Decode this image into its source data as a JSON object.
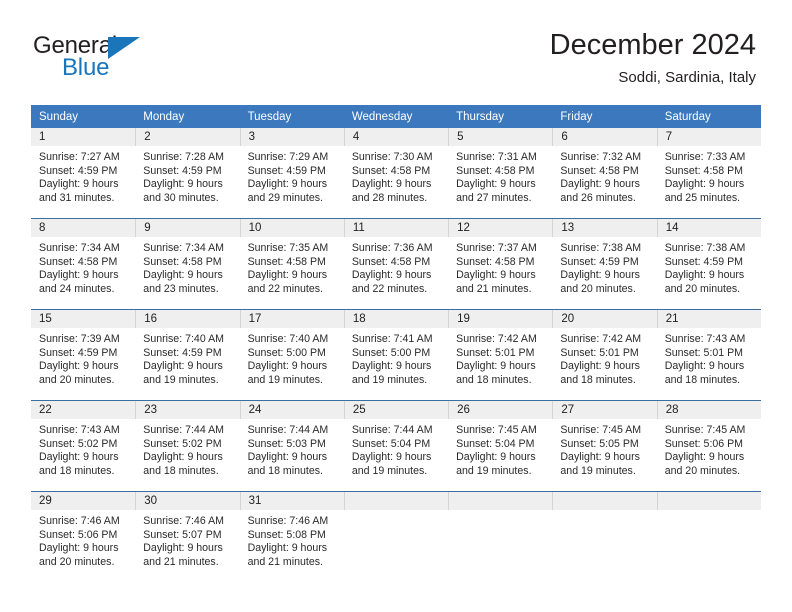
{
  "brand": {
    "name_top": "General",
    "name_bottom": "Blue",
    "accent_color": "#1b75bb",
    "text_color": "#231f20"
  },
  "header": {
    "title": "December 2024",
    "subtitle": "Soddi, Sardinia, Italy"
  },
  "theme": {
    "header_row_bg": "#3b78bd",
    "header_row_text": "#ffffff",
    "daynum_band_bg": "#efefef",
    "row_separator": "#3b6ea5",
    "cell_text": "#2a2a2a"
  },
  "weekday_headers": [
    "Sunday",
    "Monday",
    "Tuesday",
    "Wednesday",
    "Thursday",
    "Friday",
    "Saturday"
  ],
  "weeks": [
    [
      {
        "day": "1",
        "sunrise": "Sunrise: 7:27 AM",
        "sunset": "Sunset: 4:59 PM",
        "daylight_line1": "Daylight: 9 hours",
        "daylight_line2": "and 31 minutes."
      },
      {
        "day": "2",
        "sunrise": "Sunrise: 7:28 AM",
        "sunset": "Sunset: 4:59 PM",
        "daylight_line1": "Daylight: 9 hours",
        "daylight_line2": "and 30 minutes."
      },
      {
        "day": "3",
        "sunrise": "Sunrise: 7:29 AM",
        "sunset": "Sunset: 4:59 PM",
        "daylight_line1": "Daylight: 9 hours",
        "daylight_line2": "and 29 minutes."
      },
      {
        "day": "4",
        "sunrise": "Sunrise: 7:30 AM",
        "sunset": "Sunset: 4:58 PM",
        "daylight_line1": "Daylight: 9 hours",
        "daylight_line2": "and 28 minutes."
      },
      {
        "day": "5",
        "sunrise": "Sunrise: 7:31 AM",
        "sunset": "Sunset: 4:58 PM",
        "daylight_line1": "Daylight: 9 hours",
        "daylight_line2": "and 27 minutes."
      },
      {
        "day": "6",
        "sunrise": "Sunrise: 7:32 AM",
        "sunset": "Sunset: 4:58 PM",
        "daylight_line1": "Daylight: 9 hours",
        "daylight_line2": "and 26 minutes."
      },
      {
        "day": "7",
        "sunrise": "Sunrise: 7:33 AM",
        "sunset": "Sunset: 4:58 PM",
        "daylight_line1": "Daylight: 9 hours",
        "daylight_line2": "and 25 minutes."
      }
    ],
    [
      {
        "day": "8",
        "sunrise": "Sunrise: 7:34 AM",
        "sunset": "Sunset: 4:58 PM",
        "daylight_line1": "Daylight: 9 hours",
        "daylight_line2": "and 24 minutes."
      },
      {
        "day": "9",
        "sunrise": "Sunrise: 7:34 AM",
        "sunset": "Sunset: 4:58 PM",
        "daylight_line1": "Daylight: 9 hours",
        "daylight_line2": "and 23 minutes."
      },
      {
        "day": "10",
        "sunrise": "Sunrise: 7:35 AM",
        "sunset": "Sunset: 4:58 PM",
        "daylight_line1": "Daylight: 9 hours",
        "daylight_line2": "and 22 minutes."
      },
      {
        "day": "11",
        "sunrise": "Sunrise: 7:36 AM",
        "sunset": "Sunset: 4:58 PM",
        "daylight_line1": "Daylight: 9 hours",
        "daylight_line2": "and 22 minutes."
      },
      {
        "day": "12",
        "sunrise": "Sunrise: 7:37 AM",
        "sunset": "Sunset: 4:58 PM",
        "daylight_line1": "Daylight: 9 hours",
        "daylight_line2": "and 21 minutes."
      },
      {
        "day": "13",
        "sunrise": "Sunrise: 7:38 AM",
        "sunset": "Sunset: 4:59 PM",
        "daylight_line1": "Daylight: 9 hours",
        "daylight_line2": "and 20 minutes."
      },
      {
        "day": "14",
        "sunrise": "Sunrise: 7:38 AM",
        "sunset": "Sunset: 4:59 PM",
        "daylight_line1": "Daylight: 9 hours",
        "daylight_line2": "and 20 minutes."
      }
    ],
    [
      {
        "day": "15",
        "sunrise": "Sunrise: 7:39 AM",
        "sunset": "Sunset: 4:59 PM",
        "daylight_line1": "Daylight: 9 hours",
        "daylight_line2": "and 20 minutes."
      },
      {
        "day": "16",
        "sunrise": "Sunrise: 7:40 AM",
        "sunset": "Sunset: 4:59 PM",
        "daylight_line1": "Daylight: 9 hours",
        "daylight_line2": "and 19 minutes."
      },
      {
        "day": "17",
        "sunrise": "Sunrise: 7:40 AM",
        "sunset": "Sunset: 5:00 PM",
        "daylight_line1": "Daylight: 9 hours",
        "daylight_line2": "and 19 minutes."
      },
      {
        "day": "18",
        "sunrise": "Sunrise: 7:41 AM",
        "sunset": "Sunset: 5:00 PM",
        "daylight_line1": "Daylight: 9 hours",
        "daylight_line2": "and 19 minutes."
      },
      {
        "day": "19",
        "sunrise": "Sunrise: 7:42 AM",
        "sunset": "Sunset: 5:01 PM",
        "daylight_line1": "Daylight: 9 hours",
        "daylight_line2": "and 18 minutes."
      },
      {
        "day": "20",
        "sunrise": "Sunrise: 7:42 AM",
        "sunset": "Sunset: 5:01 PM",
        "daylight_line1": "Daylight: 9 hours",
        "daylight_line2": "and 18 minutes."
      },
      {
        "day": "21",
        "sunrise": "Sunrise: 7:43 AM",
        "sunset": "Sunset: 5:01 PM",
        "daylight_line1": "Daylight: 9 hours",
        "daylight_line2": "and 18 minutes."
      }
    ],
    [
      {
        "day": "22",
        "sunrise": "Sunrise: 7:43 AM",
        "sunset": "Sunset: 5:02 PM",
        "daylight_line1": "Daylight: 9 hours",
        "daylight_line2": "and 18 minutes."
      },
      {
        "day": "23",
        "sunrise": "Sunrise: 7:44 AM",
        "sunset": "Sunset: 5:02 PM",
        "daylight_line1": "Daylight: 9 hours",
        "daylight_line2": "and 18 minutes."
      },
      {
        "day": "24",
        "sunrise": "Sunrise: 7:44 AM",
        "sunset": "Sunset: 5:03 PM",
        "daylight_line1": "Daylight: 9 hours",
        "daylight_line2": "and 18 minutes."
      },
      {
        "day": "25",
        "sunrise": "Sunrise: 7:44 AM",
        "sunset": "Sunset: 5:04 PM",
        "daylight_line1": "Daylight: 9 hours",
        "daylight_line2": "and 19 minutes."
      },
      {
        "day": "26",
        "sunrise": "Sunrise: 7:45 AM",
        "sunset": "Sunset: 5:04 PM",
        "daylight_line1": "Daylight: 9 hours",
        "daylight_line2": "and 19 minutes."
      },
      {
        "day": "27",
        "sunrise": "Sunrise: 7:45 AM",
        "sunset": "Sunset: 5:05 PM",
        "daylight_line1": "Daylight: 9 hours",
        "daylight_line2": "and 19 minutes."
      },
      {
        "day": "28",
        "sunrise": "Sunrise: 7:45 AM",
        "sunset": "Sunset: 5:06 PM",
        "daylight_line1": "Daylight: 9 hours",
        "daylight_line2": "and 20 minutes."
      }
    ],
    [
      {
        "day": "29",
        "sunrise": "Sunrise: 7:46 AM",
        "sunset": "Sunset: 5:06 PM",
        "daylight_line1": "Daylight: 9 hours",
        "daylight_line2": "and 20 minutes."
      },
      {
        "day": "30",
        "sunrise": "Sunrise: 7:46 AM",
        "sunset": "Sunset: 5:07 PM",
        "daylight_line1": "Daylight: 9 hours",
        "daylight_line2": "and 21 minutes."
      },
      {
        "day": "31",
        "sunrise": "Sunrise: 7:46 AM",
        "sunset": "Sunset: 5:08 PM",
        "daylight_line1": "Daylight: 9 hours",
        "daylight_line2": "and 21 minutes."
      },
      {
        "day": "",
        "sunrise": "",
        "sunset": "",
        "daylight_line1": "",
        "daylight_line2": ""
      },
      {
        "day": "",
        "sunrise": "",
        "sunset": "",
        "daylight_line1": "",
        "daylight_line2": ""
      },
      {
        "day": "",
        "sunrise": "",
        "sunset": "",
        "daylight_line1": "",
        "daylight_line2": ""
      },
      {
        "day": "",
        "sunrise": "",
        "sunset": "",
        "daylight_line1": "",
        "daylight_line2": ""
      }
    ]
  ]
}
